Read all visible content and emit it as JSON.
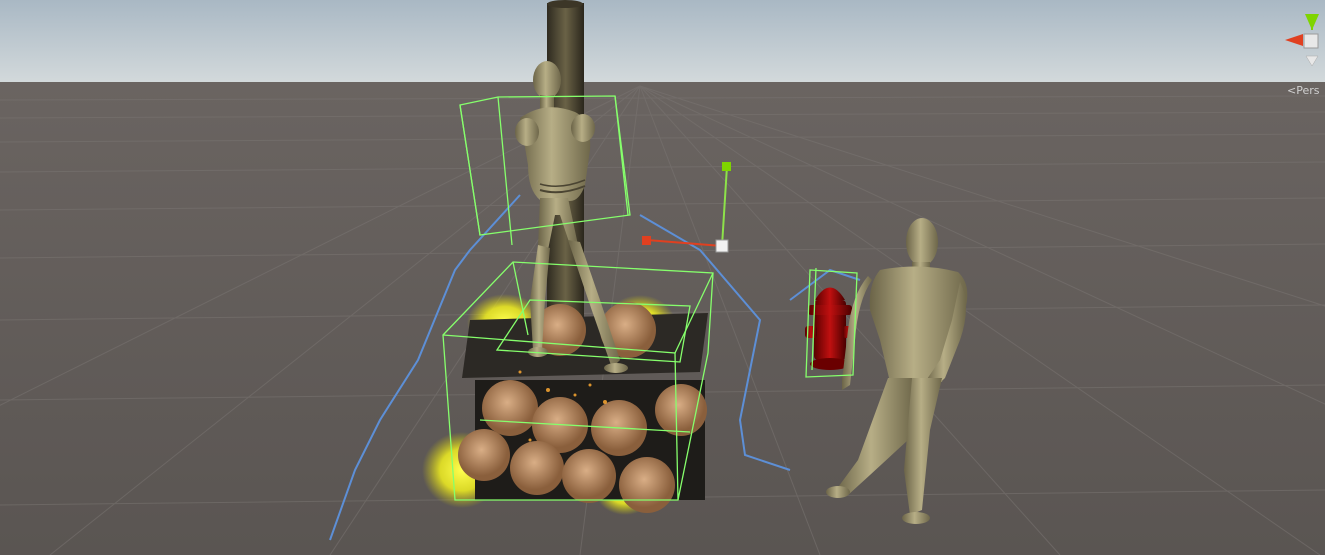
{
  "scene_view": {
    "projection_label": "Pers",
    "camera_mode": "perspective"
  },
  "gizmo_axes": [
    {
      "axis": "y",
      "color": "#7fd400"
    },
    {
      "axis": "x",
      "color": "#e04020"
    },
    {
      "axis": "z",
      "color": "#3a6fd8"
    }
  ],
  "colors": {
    "sky_top": "#b6c4cf",
    "horizon": "#cfd6d9",
    "ground": "#5f5a57",
    "selection_outline": "#5a8fd8",
    "bounds_box": "#86ff6c",
    "light_glow": "#ffff40",
    "character_skin": "#a29a74",
    "hydrant_red": "#a30808",
    "wood": "#a37a55"
  },
  "objects": [
    "wooden-post",
    "bound-character",
    "log-pile",
    "fire-lights",
    "fire-hydrant",
    "standing-character"
  ]
}
